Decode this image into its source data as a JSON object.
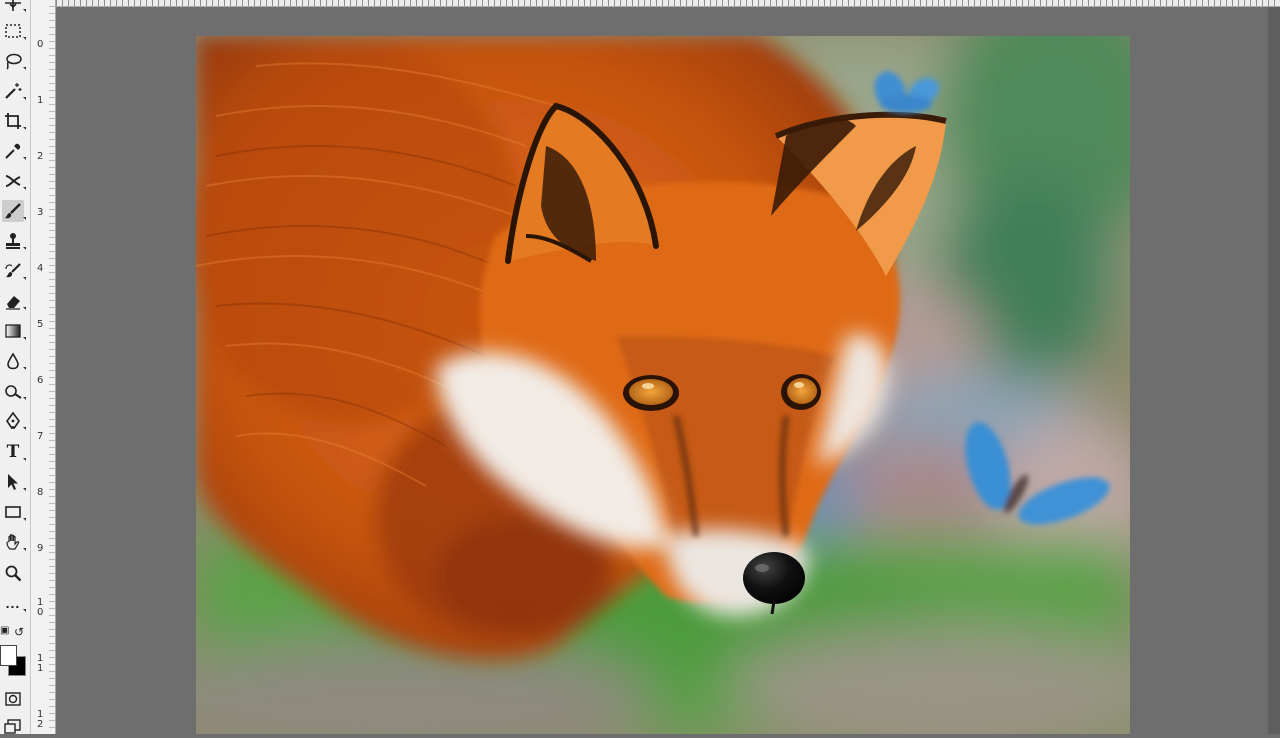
{
  "ruler": {
    "vertical_numbers": [
      "0",
      "1",
      "2",
      "3",
      "4",
      "5",
      "6",
      "7",
      "8",
      "9",
      "1\n0",
      "1\n1",
      "1\n2"
    ]
  },
  "tools": [
    {
      "name": "move-tool",
      "icon": "move-icon"
    },
    {
      "name": "marquee-tool",
      "icon": "rectangular-marquee-icon"
    },
    {
      "name": "lasso-tool",
      "icon": "lasso-icon"
    },
    {
      "name": "magic-wand-tool",
      "icon": "magic-wand-icon"
    },
    {
      "name": "crop-tool",
      "icon": "crop-icon"
    },
    {
      "name": "eyedropper-tool",
      "icon": "eyedropper-icon"
    },
    {
      "name": "healing-tool",
      "icon": "healing-brush-icon"
    },
    {
      "name": "brush-tool",
      "icon": "brush-icon",
      "active": true
    },
    {
      "name": "clone-stamp-tool",
      "icon": "clone-stamp-icon"
    },
    {
      "name": "history-brush-tool",
      "icon": "history-brush-icon"
    },
    {
      "name": "eraser-tool",
      "icon": "eraser-icon"
    },
    {
      "name": "gradient-tool",
      "icon": "gradient-icon"
    },
    {
      "name": "blur-tool",
      "icon": "blur-drop-icon"
    },
    {
      "name": "dodge-tool",
      "icon": "dodge-icon"
    },
    {
      "name": "pen-tool",
      "icon": "pen-icon"
    },
    {
      "name": "type-tool",
      "icon": "type-icon",
      "label": "T"
    },
    {
      "name": "path-selection-tool",
      "icon": "arrow-cursor-icon"
    },
    {
      "name": "rectangle-tool",
      "icon": "rectangle-icon"
    },
    {
      "name": "hand-tool",
      "icon": "hand-icon"
    },
    {
      "name": "zoom-tool",
      "icon": "zoom-icon"
    },
    {
      "name": "more-tools",
      "icon": "more-dots-icon",
      "label": "..."
    }
  ],
  "colors": {
    "foreground": "#ffffff",
    "background": "#000000",
    "workspace": "#6e6e6e",
    "toolbar": "#f0f0f0"
  },
  "canvas": {
    "content": "digital painting of a red fox with blue butterflies"
  }
}
